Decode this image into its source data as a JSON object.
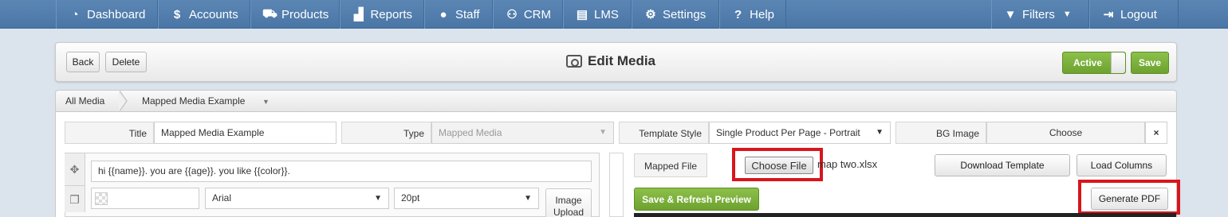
{
  "nav": {
    "items": [
      {
        "label": "Dashboard",
        "icon": "dashboard-icon"
      },
      {
        "label": "Accounts",
        "icon": "dollar-icon"
      },
      {
        "label": "Products",
        "icon": "cart-icon"
      },
      {
        "label": "Reports",
        "icon": "chart-icon"
      },
      {
        "label": "Staff",
        "icon": "user-icon"
      },
      {
        "label": "CRM",
        "icon": "users-icon"
      },
      {
        "label": "LMS",
        "icon": "book-icon"
      },
      {
        "label": "Settings",
        "icon": "gear-icon"
      },
      {
        "label": "Help",
        "icon": "question-icon"
      }
    ],
    "filters_label": "Filters",
    "logout_label": "Logout"
  },
  "toolbar": {
    "back_label": "Back",
    "delete_label": "Delete",
    "title": "Edit Media",
    "active_label": "Active",
    "save_label": "Save"
  },
  "breadcrumb": {
    "root": "All Media",
    "current": "Mapped Media Example"
  },
  "form": {
    "title_label": "Title",
    "title_value": "Mapped Media Example",
    "type_label": "Type",
    "type_value": "Mapped Media",
    "template_label": "Template Style",
    "template_value": "Single Product Per Page - Portrait",
    "bg_label": "BG Image",
    "bg_choose": "Choose",
    "bg_clear": "×"
  },
  "editor": {
    "text_value": "hi {{name}}. you are {{age}}. you like {{color}}.",
    "font_value": "Arial",
    "size_value": "20pt",
    "image_upload_line1": "Image",
    "image_upload_line2": "Upload"
  },
  "mapping": {
    "mapped_file_label": "Mapped File",
    "choose_file_label": "Choose File",
    "file_name": "map two.xlsx",
    "download_template_label": "Download Template",
    "load_columns_label": "Load Columns",
    "save_refresh_label": "Save & Refresh Preview",
    "generate_pdf_label": "Generate PDF"
  }
}
